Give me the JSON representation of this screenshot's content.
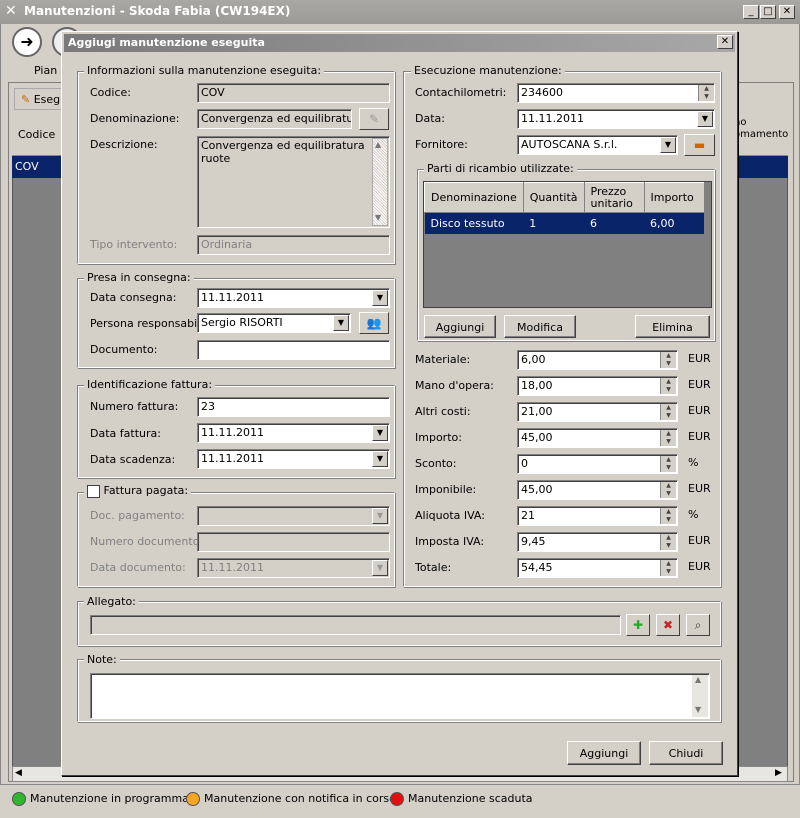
{
  "parent": {
    "title": "Manutenzioni - Skoda Fabia (CW194EX)",
    "tab": "Pian",
    "toolbar_btn": "Eseg",
    "col_codice": "Codice",
    "col_last": "no\nomamento",
    "row_code": "COV"
  },
  "status": [
    {
      "label": "Manutenzione in programma",
      "color": "#2eb82e"
    },
    {
      "label": "Manutenzione con notifica in corso",
      "color": "#f5a623"
    },
    {
      "label": "Manutenzione scaduta",
      "color": "#e01010"
    }
  ],
  "dialog": {
    "title": "Aggiugi manutenzione eseguita",
    "info": {
      "legend": "Informazioni sulla manutenzione eseguita:",
      "codice_label": "Codice:",
      "codice": "COV",
      "denom_label": "Denominazione:",
      "denom": "Convergenza ed equilibratura",
      "descr_label": "Descrizione:",
      "descr": "Convergenza ed equilibratura ruote",
      "tipo_label": "Tipo intervento:",
      "tipo": "Ordinaria"
    },
    "presa": {
      "legend": "Presa in consegna:",
      "data_label": "Data consegna:",
      "data": "11.11.2011",
      "persona_label": "Persona responsabile:",
      "persona": "Sergio RISORTI",
      "doc_label": "Documento:",
      "doc": ""
    },
    "fattura": {
      "legend": "Identificazione fattura:",
      "num_label": "Numero fattura:",
      "num": "23",
      "data_label": "Data fattura:",
      "data": "11.11.2011",
      "scad_label": "Data scadenza:",
      "scad": "11.11.2011"
    },
    "pagata": {
      "legend": "Fattura pagata:",
      "doc_label": "Doc. pagamento:",
      "num_label": "Numero documento:",
      "data_label": "Data documento:",
      "data": "11.11.2011"
    },
    "esec": {
      "legend": "Esecuzione manutenzione:",
      "km_label": "Contachilometri:",
      "km": "234600",
      "data_label": "Data:",
      "data": "11.11.2011",
      "forn_label": "Fornitore:",
      "forn": "AUTOSCANA S.r.l."
    },
    "parti": {
      "legend": "Parti di ricambio utilizzate:",
      "headers": [
        "Denominazione",
        "Quantità",
        "Prezzo unitario",
        "Importo"
      ],
      "row": [
        "Disco tessuto",
        "1",
        "6",
        "6,00"
      ],
      "add": "Aggiungi",
      "edit": "Modifica",
      "del": "Elimina"
    },
    "costs": [
      {
        "label": "Materiale:",
        "value": "6,00",
        "unit": "EUR"
      },
      {
        "label": "Mano d'opera:",
        "value": "18,00",
        "unit": "EUR"
      },
      {
        "label": "Altri costi:",
        "value": "21,00",
        "unit": "EUR"
      },
      {
        "label": "Importo:",
        "value": "45,00",
        "unit": "EUR"
      },
      {
        "label": "Sconto:",
        "value": "0",
        "unit": "%"
      },
      {
        "label": "Imponibile:",
        "value": "45,00",
        "unit": "EUR"
      },
      {
        "label": "Aliquota IVA:",
        "value": "21",
        "unit": "%"
      },
      {
        "label": "Imposta IVA:",
        "value": "9,45",
        "unit": "EUR"
      },
      {
        "label": "Totale:",
        "value": "54,45",
        "unit": "EUR"
      }
    ],
    "allegato": "Allegato:",
    "note": "Note:",
    "ok": "Aggiungi",
    "cancel": "Chiudi"
  }
}
